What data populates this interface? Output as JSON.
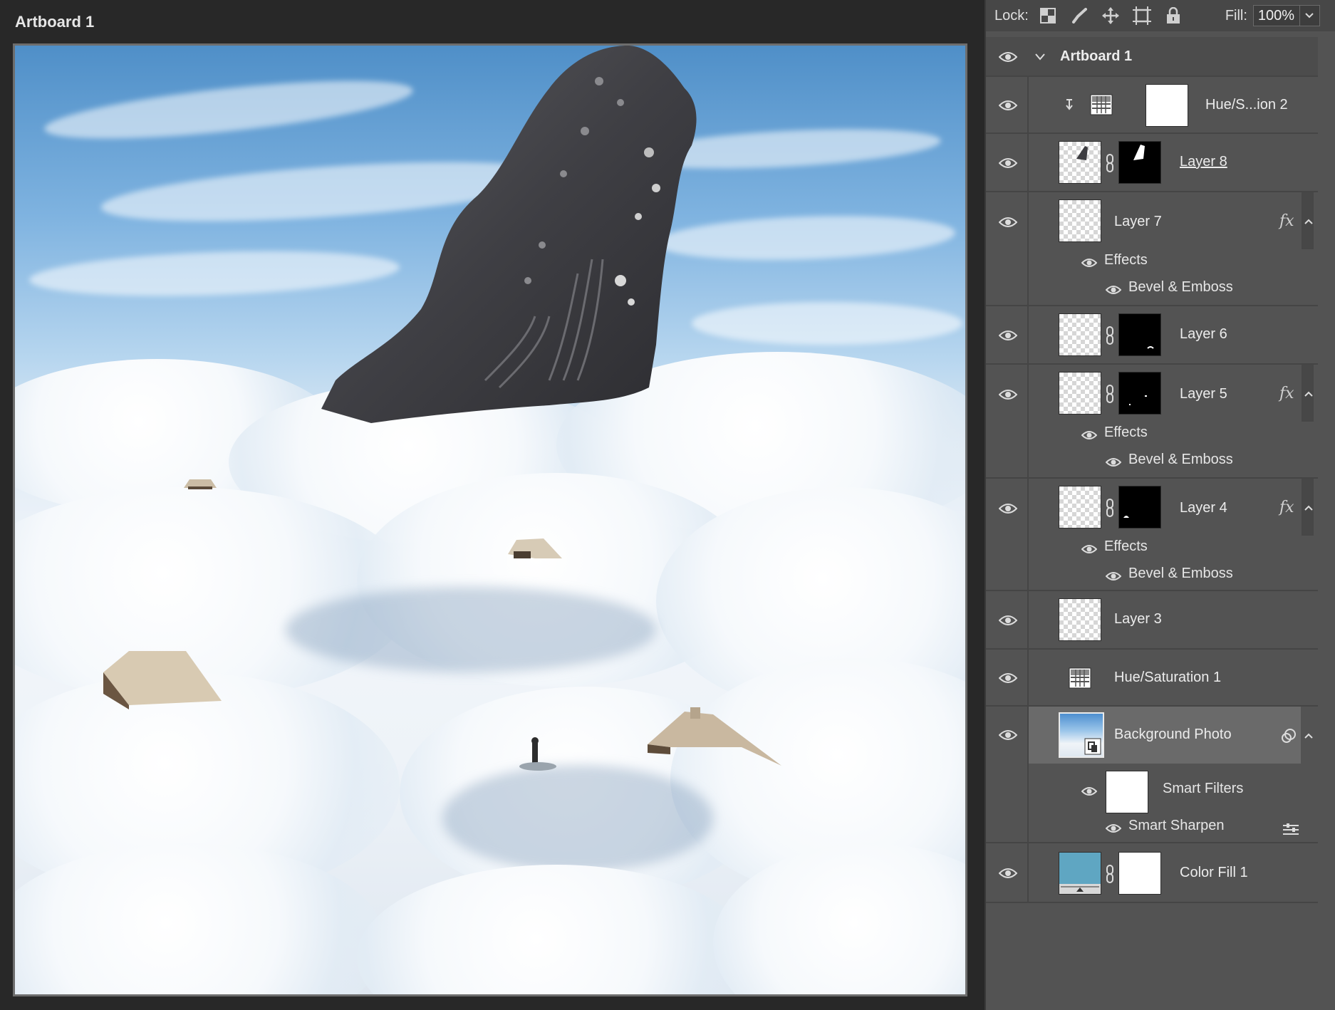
{
  "canvas": {
    "artboard_title": "Artboard 1"
  },
  "toolbar": {
    "lock_label": "Lock:",
    "lock_icons": [
      "lock-transparent-pixels-icon",
      "lock-image-pixels-icon",
      "lock-position-icon",
      "lock-artboard-icon",
      "lock-all-icon"
    ],
    "fill_label": "Fill:",
    "fill_value": "100%"
  },
  "layers": {
    "artboard": {
      "name": "Artboard 1",
      "expanded": true
    },
    "hue_sat_2": {
      "name": "Hue/S...ion 2"
    },
    "layer8": {
      "name": "Layer 8"
    },
    "layer7": {
      "name": "Layer 7",
      "effects": "Effects",
      "effect": "Bevel & Emboss"
    },
    "layer6": {
      "name": "Layer 6"
    },
    "layer5": {
      "name": "Layer 5",
      "effects": "Effects",
      "effect": "Bevel & Emboss"
    },
    "layer4": {
      "name": "Layer 4",
      "effects": "Effects",
      "effect": "Bevel & Emboss"
    },
    "layer3": {
      "name": "Layer 3"
    },
    "hue_sat_1": {
      "name": "Hue/Saturation 1"
    },
    "background": {
      "name": "Background Photo",
      "smart_filters": "Smart Filters",
      "filter": "Smart Sharpen"
    },
    "color_fill": {
      "name": "Color Fill 1",
      "fill_color": "#5fa6c2"
    }
  }
}
